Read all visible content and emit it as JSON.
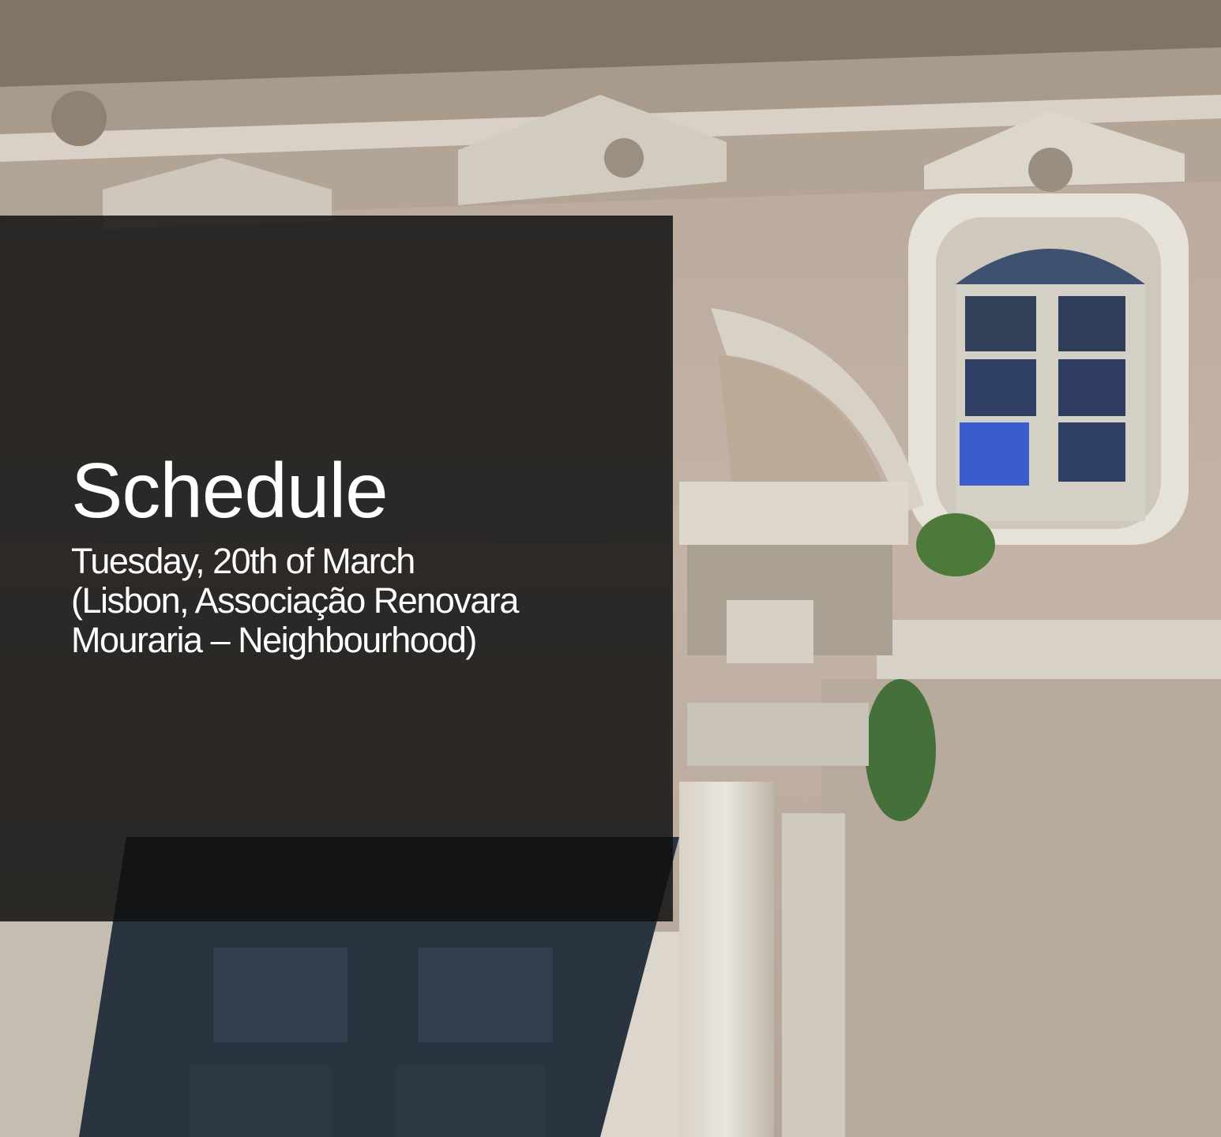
{
  "slide": {
    "title": "Schedule",
    "subtitle_lines": [
      "Tuesday, 20th of March",
      "(Lisbon, Associação Renovara",
      "Mouraria – Neighbourhood)"
    ]
  },
  "background": {
    "description_icon": "building-facade-photo",
    "overlay_color": "#0e0e0e"
  }
}
